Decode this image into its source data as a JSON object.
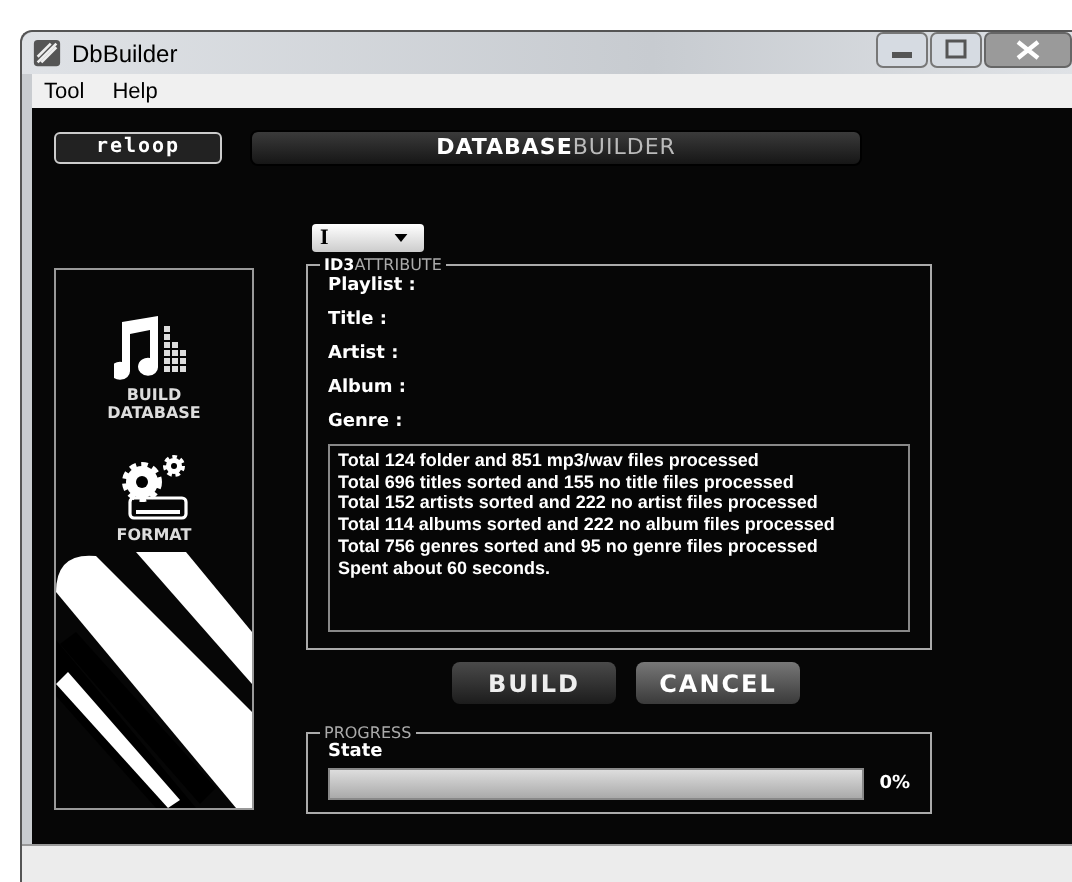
{
  "window": {
    "title": "DbBuilder"
  },
  "menu": [
    "Tool",
    "Help"
  ],
  "header": {
    "logo": "reloop",
    "title": "**DATABASE**BUILDER"
  },
  "sidebar": {
    "items": [
      {
        "label": "BUILD\nDATABASE",
        "kind": "music"
      },
      {
        "label": "FORMAT",
        "kind": "format"
      }
    ]
  },
  "dropdown": {
    "value": "I"
  },
  "id3": {
    "legend": "**ID3**ATTRIBUTE",
    "fields": [
      {
        "label": "Playlist :"
      },
      {
        "label": "Title :"
      },
      {
        "label": "Artist :"
      },
      {
        "label": "Album :"
      },
      {
        "label": "Genre :"
      }
    ],
    "log": [
      "Total 124 folder and 851 mp3/wav files processed",
      "Total 696 titles sorted and 155 no title files processed",
      "Total 152 artists sorted and 222 no artist files processed",
      "Total 114 albums sorted and 222 no album files processed",
      "Total 756 genres sorted and 95 no genre files processed",
      "Spent about 60 seconds."
    ]
  },
  "buttons": [
    {
      "label": "BUILD",
      "disabled": true
    },
    {
      "label": "CANCEL",
      "disabled": false
    }
  ],
  "progress": {
    "legend": "PROGRESS",
    "label": "State",
    "level": 0,
    "reading": "0%"
  }
}
